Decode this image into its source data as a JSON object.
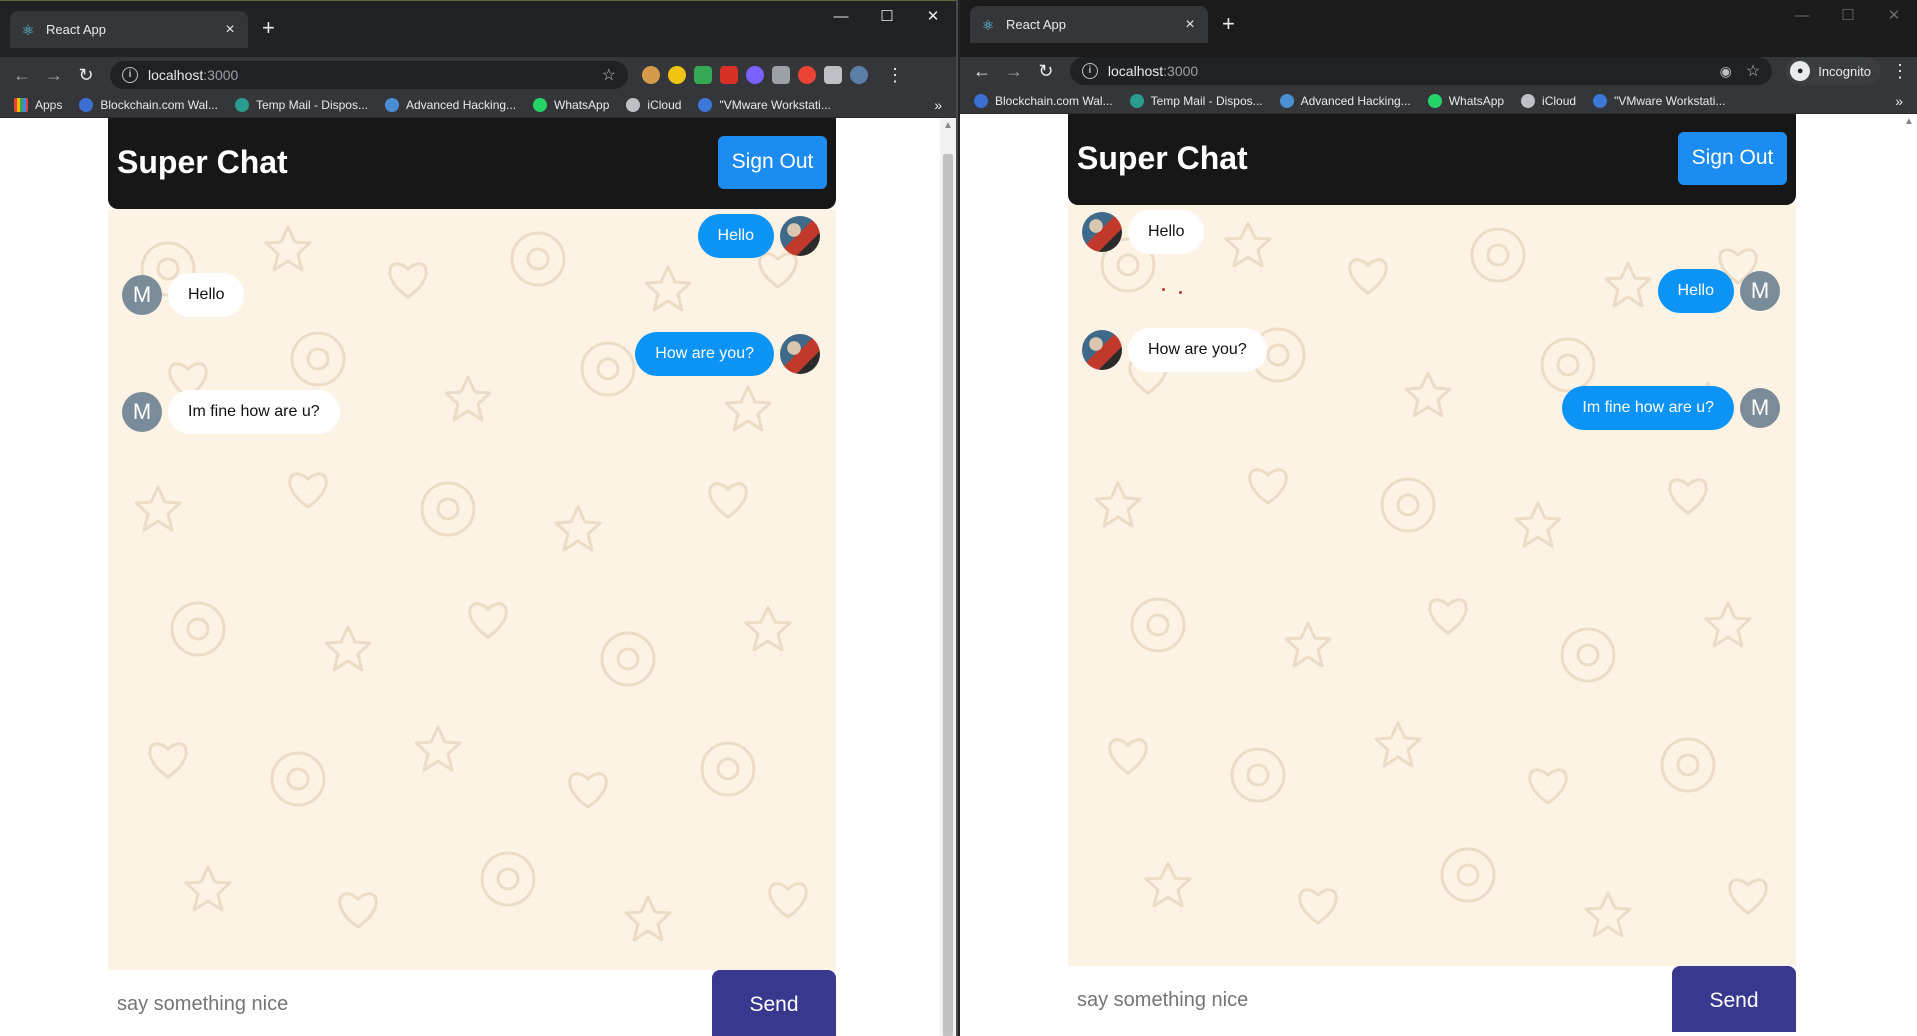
{
  "browsers": [
    {
      "tab_title": "React App",
      "url_host": "localhost",
      "url_port": ":3000",
      "incognito_label": "",
      "bookmarks": [
        {
          "label": "Apps"
        },
        {
          "label": "Blockchain.com Wal..."
        },
        {
          "label": "Temp Mail - Dispos..."
        },
        {
          "label": "Advanced Hacking..."
        },
        {
          "label": "WhatsApp"
        },
        {
          "label": "iCloud"
        },
        {
          "label": "\"VMware Workstati..."
        }
      ],
      "app": {
        "title": "Super Chat",
        "signout_label": "Sign Out",
        "input_placeholder": "say something nice",
        "send_label": "Send",
        "messages": [
          {
            "side": "sent",
            "text": "Hello",
            "avatar": "photo"
          },
          {
            "side": "received",
            "text": "Hello",
            "avatar": "M"
          },
          {
            "side": "sent",
            "text": "How are you?",
            "avatar": "photo"
          },
          {
            "side": "received",
            "text": "Im fine how are u?",
            "avatar": "M"
          }
        ]
      }
    },
    {
      "tab_title": "React App",
      "url_host": "localhost",
      "url_port": ":3000",
      "incognito_label": "Incognito",
      "bookmarks": [
        {
          "label": "Blockchain.com Wal..."
        },
        {
          "label": "Temp Mail - Dispos..."
        },
        {
          "label": "Advanced Hacking..."
        },
        {
          "label": "WhatsApp"
        },
        {
          "label": "iCloud"
        },
        {
          "label": "\"VMware Workstati..."
        }
      ],
      "app": {
        "title": "Super Chat",
        "signout_label": "Sign Out",
        "input_placeholder": "say something nice",
        "send_label": "Send",
        "messages": [
          {
            "side": "received",
            "text": "Hello",
            "avatar": "photo"
          },
          {
            "side": "sent",
            "text": "Hello",
            "avatar": "M"
          },
          {
            "side": "received",
            "text": "How are you?",
            "avatar": "photo"
          },
          {
            "side": "sent",
            "text": "Im fine how are u?",
            "avatar": "M"
          }
        ]
      }
    }
  ],
  "colors": {
    "sent_bubble": "#0b93f6",
    "signout_button": "#1c8cf0",
    "send_button": "#38388f",
    "header_bg": "#181717",
    "chat_bg": "#fdf3e5"
  }
}
